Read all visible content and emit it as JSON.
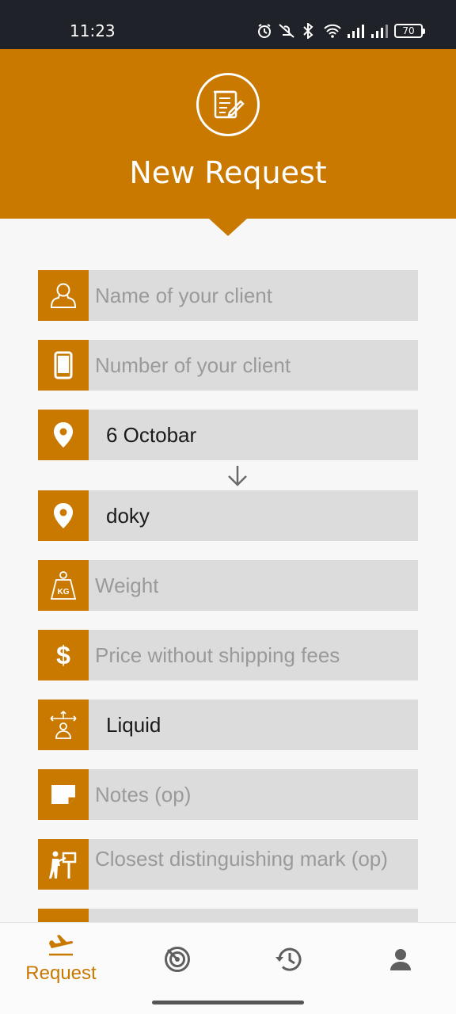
{
  "status_bar": {
    "time": "11:23",
    "battery": "70"
  },
  "header": {
    "title": "New Request",
    "icon": "document-edit-icon"
  },
  "form": {
    "client_name": {
      "placeholder": "Name of your client",
      "icon": "person-icon"
    },
    "client_number": {
      "placeholder": "Number of your client",
      "icon": "phone-icon"
    },
    "from_location": {
      "value": "6 Octobar",
      "icon": "location-pin-icon"
    },
    "to_location": {
      "value": "doky",
      "icon": "location-pin-icon"
    },
    "weight": {
      "placeholder": "Weight",
      "icon": "weight-kg-icon",
      "icon_text": "KG"
    },
    "price": {
      "placeholder": "Price without shipping fees",
      "icon": "dollar-icon",
      "icon_text": "$"
    },
    "package_type": {
      "value": "Liquid",
      "icon": "package-type-icon"
    },
    "notes": {
      "placeholder": "Notes (op)",
      "icon": "note-icon"
    },
    "landmark": {
      "placeholder": "Closest distinguishing mark (op)",
      "icon": "landmark-sign-icon"
    }
  },
  "bottom_nav": {
    "items": [
      {
        "label": "Request",
        "icon": "airplane-icon",
        "active": true
      },
      {
        "label": "",
        "icon": "radar-icon"
      },
      {
        "label": "",
        "icon": "history-icon"
      },
      {
        "label": "",
        "icon": "profile-icon"
      }
    ]
  },
  "colors": {
    "primary": "#c97800",
    "field_bg": "#dcdcdc",
    "status_bar": "#1f2329"
  }
}
